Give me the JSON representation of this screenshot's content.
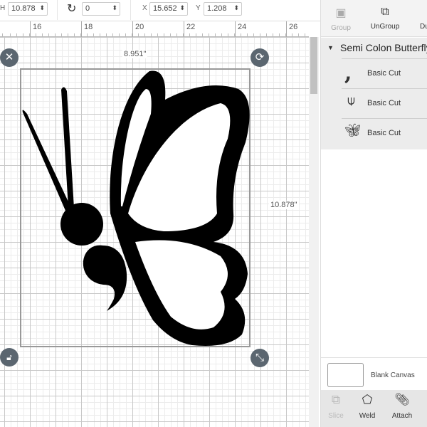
{
  "toolbar": {
    "h_label": "H",
    "h_value": "10.878",
    "rotate_value": "0",
    "x_label": "X",
    "x_value": "15.652",
    "y_label": "Y",
    "y_value": "1.208"
  },
  "ruler": {
    "ticks": [
      "16",
      "18",
      "20",
      "22",
      "24",
      "26"
    ]
  },
  "selection": {
    "width_label": "8.951\"",
    "height_label": "10.878\""
  },
  "panel": {
    "tools": [
      {
        "label": "Group",
        "enabled": false
      },
      {
        "label": "UnGroup",
        "enabled": true
      },
      {
        "label": "Du",
        "enabled": true
      }
    ],
    "group_name": "Semi Colon Butterfly",
    "layers": [
      {
        "label": "Basic Cut",
        "thumb": "comma-dot"
      },
      {
        "label": "Basic Cut",
        "thumb": "antenna"
      },
      {
        "label": "Basic Cut",
        "thumb": "butterfly-wing"
      }
    ],
    "canvas_label": "Blank Canvas",
    "bottom_tools": [
      {
        "label": "Slice",
        "enabled": false
      },
      {
        "label": "Weld",
        "enabled": true
      },
      {
        "label": "Attach",
        "enabled": true
      }
    ]
  }
}
